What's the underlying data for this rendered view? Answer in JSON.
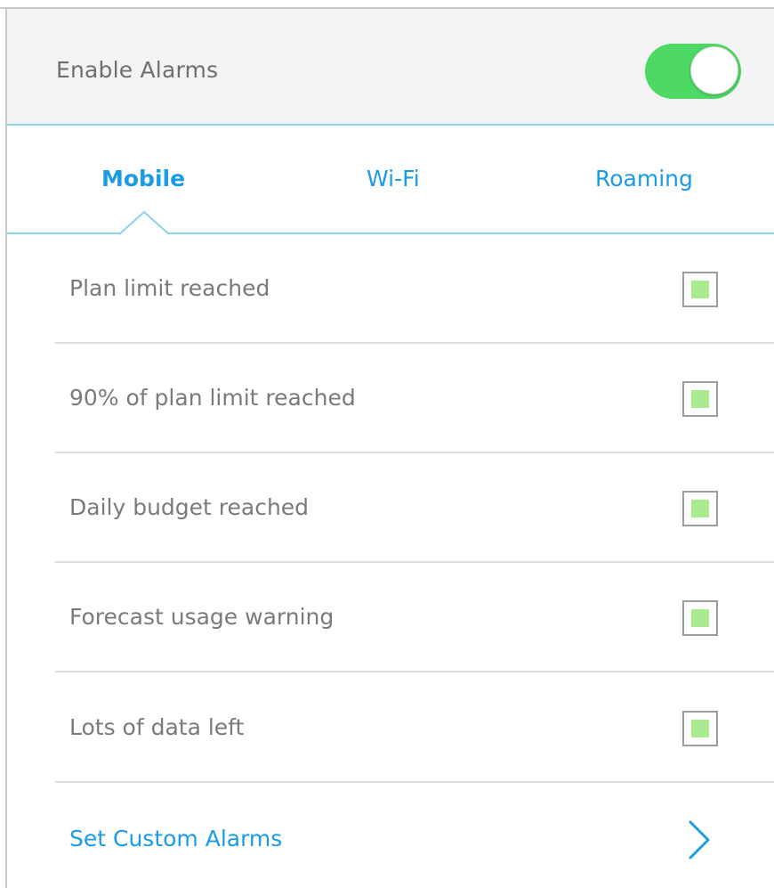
{
  "header": {
    "label": "Enable Alarms",
    "toggle_on": true,
    "toggle_color": "#4cd964"
  },
  "tabs": [
    {
      "label": "Mobile",
      "active": true
    },
    {
      "label": "Wi-Fi",
      "active": false
    },
    {
      "label": "Roaming",
      "active": false
    }
  ],
  "alarms": [
    {
      "label": "Plan limit reached",
      "checked": true
    },
    {
      "label": "90% of plan limit reached",
      "checked": true
    },
    {
      "label": "Daily budget reached",
      "checked": true
    },
    {
      "label": "Forecast usage warning",
      "checked": true
    },
    {
      "label": "Lots of data left",
      "checked": true
    }
  ],
  "custom": {
    "label": "Set Custom Alarms",
    "icon": "chevron-right-icon"
  },
  "colors": {
    "accent": "#1a9be5",
    "divider_accent": "#8fd0f1",
    "checkbox_fill": "#a9ec8f"
  }
}
